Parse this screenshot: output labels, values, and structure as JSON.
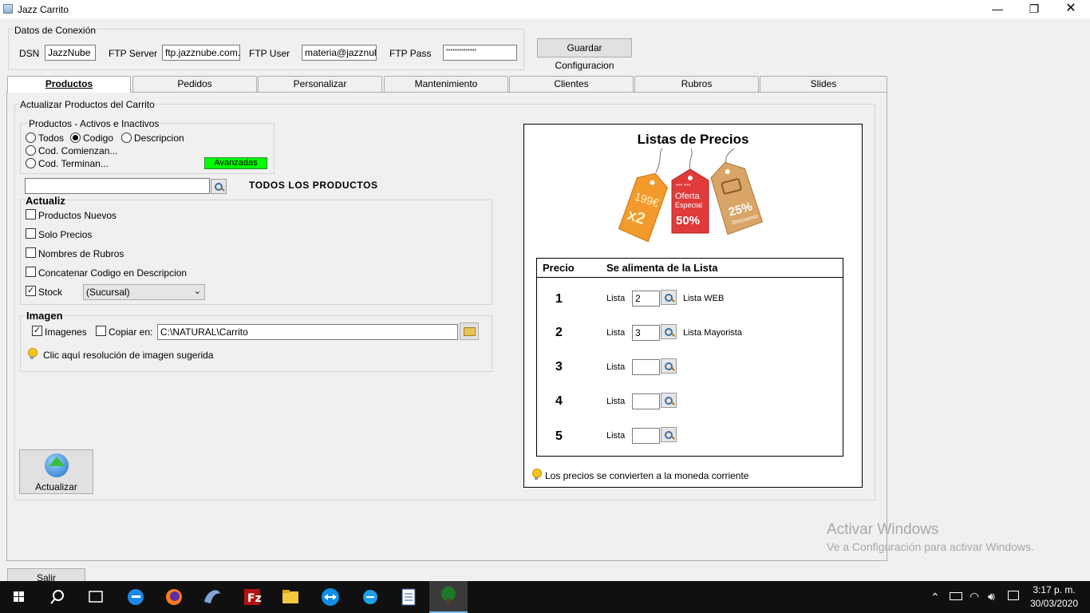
{
  "window": {
    "title": "Jazz Carrito"
  },
  "connection": {
    "legend": "Datos de Conexión",
    "dsn_label": "DSN",
    "dsn_value": "JazzNube",
    "ftp_server_label": "FTP Server",
    "ftp_server_value": "ftp.jazznube.com.ar",
    "ftp_user_label": "FTP User",
    "ftp_user_value": "materia@jazznube",
    "ftp_pass_label": "FTP Pass",
    "ftp_pass_value": "**************",
    "save_button": "Guardar Configuracion"
  },
  "tabs": [
    "Productos",
    "Pedidos",
    "Personalizar",
    "Mantenimiento",
    "Clientes",
    "Rubros",
    "Slides"
  ],
  "products": {
    "section_title": "Actualizar Productos del Carrito",
    "filter_legend": "Productos - Activos e Inactivos",
    "radio_todos": "Todos",
    "radio_codigo": "Codigo",
    "radio_descripcion": "Descripcion",
    "radio_comienzan": "Cod. Comienzan...",
    "radio_terminan": "Cod. Terminan...",
    "advanced_button": "Avanzadas",
    "search_value": "",
    "all_products_label": "TODOS LOS PRODUCTOS",
    "update_legend": "Actualiz",
    "chk_nuevos": "Productos Nuevos",
    "chk_precios": "Solo Precios",
    "chk_rubros": "Nombres de Rubros",
    "chk_concatenar": "Concatenar Codigo en Descripcion",
    "chk_stock": "Stock",
    "stock_select": "(Sucursal)",
    "image_legend": "Imagen",
    "chk_imagenes": "Imagenes",
    "chk_copiar": "Copiar en:",
    "copy_path": "C:\\NATURAL\\Carrito",
    "image_hint": "Clic aquí resolución de imagen sugerida",
    "update_button": "Actualizar"
  },
  "prices": {
    "title": "Listas de Precios",
    "tag1_top": "199€",
    "tag1_bottom": "x2",
    "tag2_stars": "*** ***",
    "tag2_top": "Oferta",
    "tag2_mid": "Especial",
    "tag2_bottom": "50%",
    "tag3_top": "25%",
    "tag3_bottom": "Descuento",
    "col_price": "Precio",
    "col_source": "Se alimenta de la Lista",
    "rows": [
      {
        "num": "1",
        "label": "Lista",
        "value": "2",
        "name": "Lista WEB"
      },
      {
        "num": "2",
        "label": "Lista",
        "value": "3",
        "name": "Lista Mayorista"
      },
      {
        "num": "3",
        "label": "Lista",
        "value": "",
        "name": ""
      },
      {
        "num": "4",
        "label": "Lista",
        "value": "",
        "name": ""
      },
      {
        "num": "5",
        "label": "Lista",
        "value": "",
        "name": ""
      }
    ],
    "hint": "Los precios se convierten a la moneda corriente"
  },
  "exit_button": "Salir",
  "watermark": {
    "line1": "Activar Windows",
    "line2": "Ve a Configuración para activar Windows."
  },
  "taskbar": {
    "time": "3:17 p. m.",
    "date": "30/03/2020"
  },
  "colors": {
    "advanced_button_bg": "#00ff00",
    "tag_orange": "#f39a2c",
    "tag_red": "#e03a3a",
    "tag_tan": "#d9a566"
  }
}
